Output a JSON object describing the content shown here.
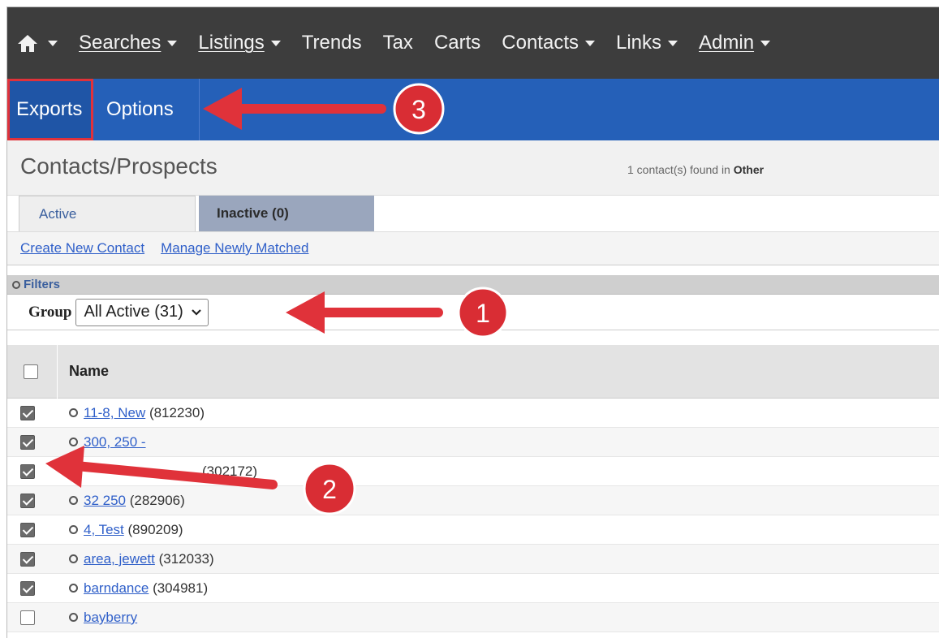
{
  "topnav": {
    "home_icon": "home-icon",
    "items": [
      {
        "label": "Searches",
        "dropdown": true
      },
      {
        "label": "Listings",
        "dropdown": true
      },
      {
        "label": "Trends",
        "dropdown": false
      },
      {
        "label": "Tax",
        "dropdown": false
      },
      {
        "label": "Carts",
        "dropdown": false
      },
      {
        "label": "Contacts",
        "dropdown": true
      },
      {
        "label": "Links",
        "dropdown": true
      },
      {
        "label": "Admin",
        "dropdown": true
      }
    ]
  },
  "subnav": {
    "exports_label": "Exports",
    "options_label": "Options"
  },
  "page": {
    "title": "Contacts/Prospects",
    "found_prefix": "1 contact(s) found in",
    "found_group": "Other"
  },
  "tabs": {
    "active_label": "Active",
    "inactive_label": "Inactive (0)"
  },
  "links": {
    "create_label": "Create New Contact",
    "manage_label": "Manage Newly Matched"
  },
  "filters": {
    "label": "Filters",
    "group_label": "Group",
    "group_value": "All Active (31)"
  },
  "table": {
    "name_header": "Name",
    "rows": [
      {
        "checked": true,
        "link": "11-8, New",
        "suffix": " (812230)"
      },
      {
        "checked": true,
        "link": "300, 250 -",
        "suffix": ""
      },
      {
        "checked": true,
        "link": "",
        "suffix": "(302172)"
      },
      {
        "checked": true,
        "link": "32 250",
        "suffix": " (282906)"
      },
      {
        "checked": true,
        "link": "4, Test",
        "suffix": " (890209)"
      },
      {
        "checked": true,
        "link": "area, jewett",
        "suffix": " (312033)"
      },
      {
        "checked": true,
        "link": "barndance",
        "suffix": " (304981)"
      },
      {
        "checked": false,
        "link": "bayberry",
        "suffix": ""
      }
    ]
  },
  "annotations": {
    "badge_1": "1",
    "badge_2": "2",
    "badge_3": "3",
    "arrow_color": "#e0323a"
  },
  "colors": {
    "topnav_bg": "#3d3d3d",
    "subnav_bg": "#2560b8",
    "link": "#2f5fc9",
    "highlight": "#e0323a"
  }
}
